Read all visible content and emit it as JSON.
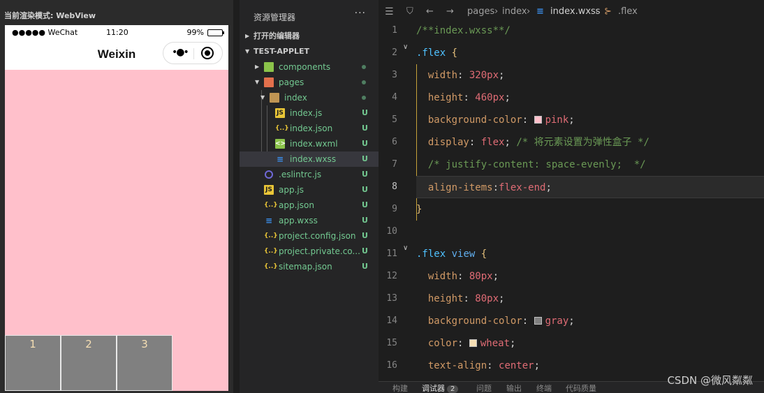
{
  "simulator": {
    "header": "当前渲染模式: WebView",
    "status": {
      "carrier": "●●●●● WeChat",
      "time": "11:20",
      "battery": "99%",
      "battery_level": 0.99
    },
    "nav_title": "Weixin",
    "items": [
      "1",
      "2",
      "3"
    ]
  },
  "explorer": {
    "title": "资源管理器",
    "more": "···",
    "open_editors": "打开的编辑器",
    "project": "TEST-APPLET",
    "tree": [
      {
        "name": "components",
        "status": ""
      },
      {
        "name": "pages",
        "status": ""
      },
      {
        "name": "index",
        "status": ""
      },
      {
        "name": "index.js",
        "status": "U"
      },
      {
        "name": "index.json",
        "status": "U"
      },
      {
        "name": "index.wxml",
        "status": "U"
      },
      {
        "name": "index.wxss",
        "status": "U"
      },
      {
        "name": ".eslintrc.js",
        "status": "U"
      },
      {
        "name": "app.js",
        "status": "U"
      },
      {
        "name": "app.json",
        "status": "U"
      },
      {
        "name": "app.wxss",
        "status": "U"
      },
      {
        "name": "project.config.json",
        "status": "U"
      },
      {
        "name": "project.private.co...",
        "status": "U"
      },
      {
        "name": "sitemap.json",
        "status": "U"
      }
    ]
  },
  "editor": {
    "breadcrumb": [
      "pages",
      "index",
      "index.wxss",
      ".flex"
    ],
    "line_numbers": [
      "1",
      "2",
      "3",
      "4",
      "5",
      "6",
      "7",
      "8",
      "9",
      "10",
      "11",
      "12",
      "13",
      "14",
      "15",
      "16"
    ],
    "code": {
      "l1": "/**index.wxss**/",
      "l2_sel": ".flex",
      "l2_brace": "{",
      "l3_prop": "width",
      "l3_val": "320px",
      "l4_prop": "height",
      "l4_val": "460px",
      "l5_prop": "background-color",
      "l5_val": "pink",
      "l6_prop": "display",
      "l6_val": "flex",
      "l6_comment": "/* 将元素设置为弹性盒子 */",
      "l7": "/* justify-content: space-evenly;  */",
      "l8_prop": "align-items",
      "l8_val": "flex-end",
      "l9": "}",
      "l11_sel": ".flex",
      "l11_tag": "view",
      "l11_brace": "{",
      "l12_prop": "width",
      "l12_val": "80px",
      "l13_prop": "height",
      "l13_val": "80px",
      "l14_prop": "background-color",
      "l14_val": "gray",
      "l15_prop": "color",
      "l15_val": "wheat",
      "l16_prop": "text-align",
      "l16_val": "center"
    },
    "bottom_tabs": [
      "构建",
      "调试器",
      "问题",
      "输出",
      "终端",
      "代码质量"
    ],
    "debugger_badge": "2",
    "watermark": "CSDN @微风粼粼"
  },
  "colors": {
    "pink": "#ffc0cb",
    "gray": "#808080",
    "wheat": "#f5deb3",
    "status_green": "#73c991"
  }
}
